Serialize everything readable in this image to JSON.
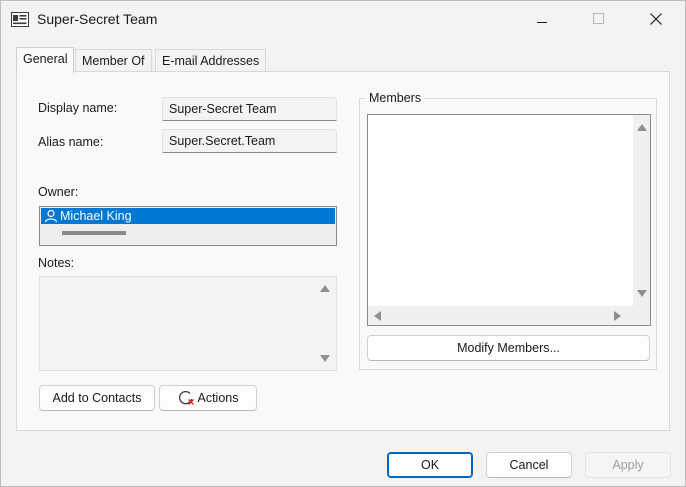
{
  "window": {
    "title": "Super-Secret Team"
  },
  "tabs": [
    {
      "label": "General",
      "active": true
    },
    {
      "label": "Member Of",
      "active": false
    },
    {
      "label": "E-mail Addresses",
      "active": false
    }
  ],
  "general": {
    "display_name_label": "Display name:",
    "display_name_value": "Super-Secret Team",
    "alias_name_label": "Alias name:",
    "alias_name_value": "Super.Secret.Team",
    "owner_label": "Owner:",
    "owner_value": "Michael King",
    "notes_label": "Notes:",
    "notes_value": "",
    "add_to_contacts_label": "Add to Contacts",
    "actions_label": "Actions"
  },
  "members": {
    "group_label": "Members",
    "modify_button_label": "Modify Members..."
  },
  "footer": {
    "ok_label": "OK",
    "cancel_label": "Cancel",
    "apply_label": "Apply",
    "apply_enabled": false
  },
  "colors": {
    "selection": "#0078d4",
    "ok_border": "#0067c0"
  },
  "icons": {
    "app": "contact-card-icon",
    "owner": "person-icon",
    "actions": "actions-icon"
  }
}
